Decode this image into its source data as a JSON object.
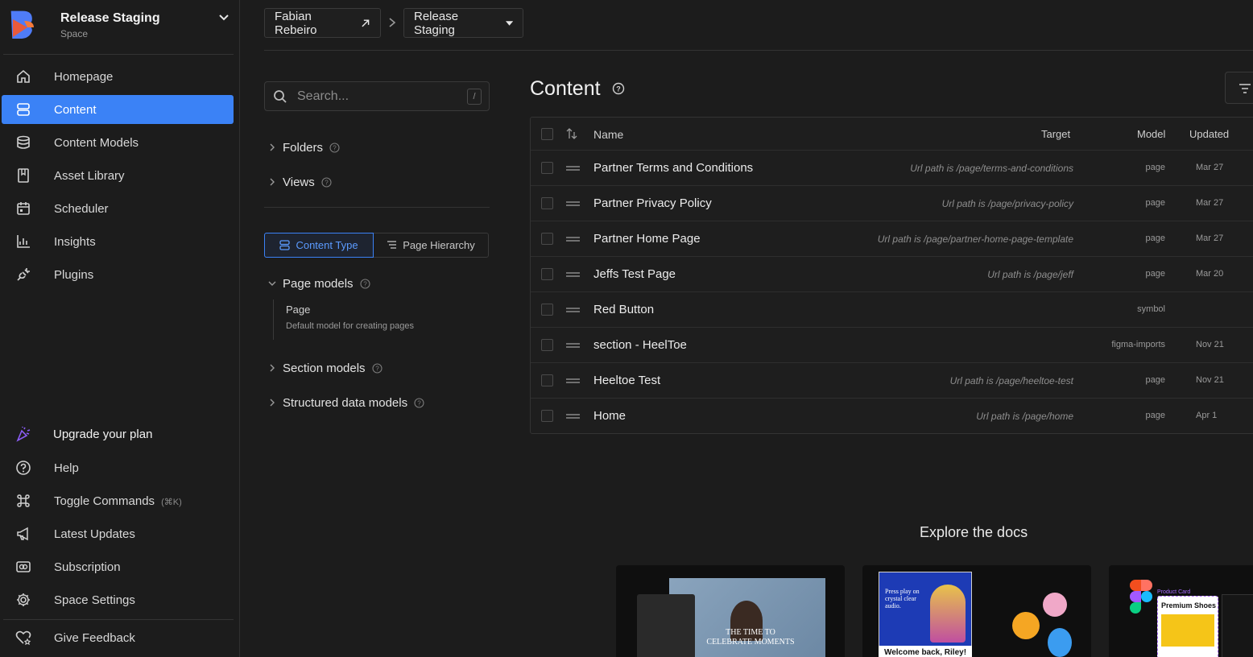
{
  "space": {
    "name": "Release Staging",
    "type": "Space"
  },
  "nav": {
    "items": [
      {
        "label": "Homepage",
        "icon": "home-icon"
      },
      {
        "label": "Content",
        "icon": "content-icon",
        "active": true
      },
      {
        "label": "Content Models",
        "icon": "database-icon"
      },
      {
        "label": "Asset Library",
        "icon": "book-icon"
      },
      {
        "label": "Scheduler",
        "icon": "calendar-icon"
      },
      {
        "label": "Insights",
        "icon": "chart-icon"
      },
      {
        "label": "Plugins",
        "icon": "plug-icon"
      }
    ],
    "upgrade": "Upgrade your plan",
    "help": "Help",
    "toggle_commands": "Toggle Commands",
    "toggle_commands_hint": "(⌘K)",
    "latest_updates": "Latest Updates",
    "subscription": "Subscription",
    "space_settings": "Space Settings",
    "give_feedback": "Give Feedback"
  },
  "breadcrumb": {
    "org": "Fabian Rebeiro",
    "space": "Release Staging"
  },
  "panel": {
    "search_placeholder": "Search...",
    "search_shortcut": "/",
    "folders": "Folders",
    "views": "Views",
    "tab_content_type": "Content Type",
    "tab_page_hierarchy": "Page Hierarchy",
    "page_models": "Page models",
    "model_page_title": "Page",
    "model_page_desc": "Default model for creating pages",
    "section_models": "Section models",
    "structured_models": "Structured data models"
  },
  "content": {
    "title": "Content",
    "columns": {
      "name": "Name",
      "target": "Target",
      "model": "Model",
      "updated": "Updated"
    },
    "rows": [
      {
        "name": "Partner Terms and Conditions",
        "target": "Url path is /page/terms-and-conditions",
        "model": "page",
        "updated": "Mar 27"
      },
      {
        "name": "Partner Privacy Policy",
        "target": "Url path is /page/privacy-policy",
        "model": "page",
        "updated": "Mar 27"
      },
      {
        "name": "Partner Home Page",
        "target": "Url path is /page/partner-home-page-template",
        "model": "page",
        "updated": "Mar 27"
      },
      {
        "name": "Jeffs Test Page",
        "target": "Url path is /page/jeff",
        "model": "page",
        "updated": "Mar 20"
      },
      {
        "name": "Red Button",
        "target": "",
        "model": "symbol",
        "updated": ""
      },
      {
        "name": "section - HeelToe",
        "target": "",
        "model": "figma-imports",
        "updated": "Nov 21"
      },
      {
        "name": "Heeltoe Test",
        "target": "Url path is /page/heeltoe-test",
        "model": "page",
        "updated": "Nov 21"
      },
      {
        "name": "Home",
        "target": "Url path is /page/home",
        "model": "page",
        "updated": "Apr 1"
      }
    ]
  },
  "docs": {
    "title": "Explore the docs",
    "card1_text": "THE TIME TO CELEBRATE MOMENTS",
    "card2_text": "Welcome back, Riley!",
    "card2_sub": "Press play on crystal clear audio.",
    "card3_title": "Premium Shoes",
    "card3_tag": "Product Card"
  },
  "colors": {
    "accent": "#3b82f6",
    "bg": "#1c1c1c",
    "upgrade": "#8b5cf6"
  }
}
